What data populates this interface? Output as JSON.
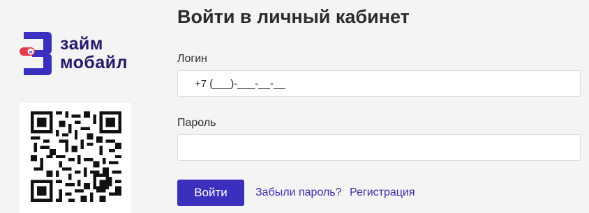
{
  "brand": {
    "line1": "займ",
    "line2": "мобайл",
    "badge": "м",
    "primary_color": "#3b2fbd",
    "accent_color": "#e8394d"
  },
  "login_form": {
    "title": "Войти в личный кабинет",
    "login_label": "Логин",
    "login_value": "+7 (___)-___-__-__",
    "password_label": "Пароль",
    "password_value": "",
    "submit_label": "Войти",
    "forgot_link": "Забыли пароль?",
    "register_link": "Регистрация"
  },
  "qr": {
    "icon": "qr-code-icon"
  }
}
